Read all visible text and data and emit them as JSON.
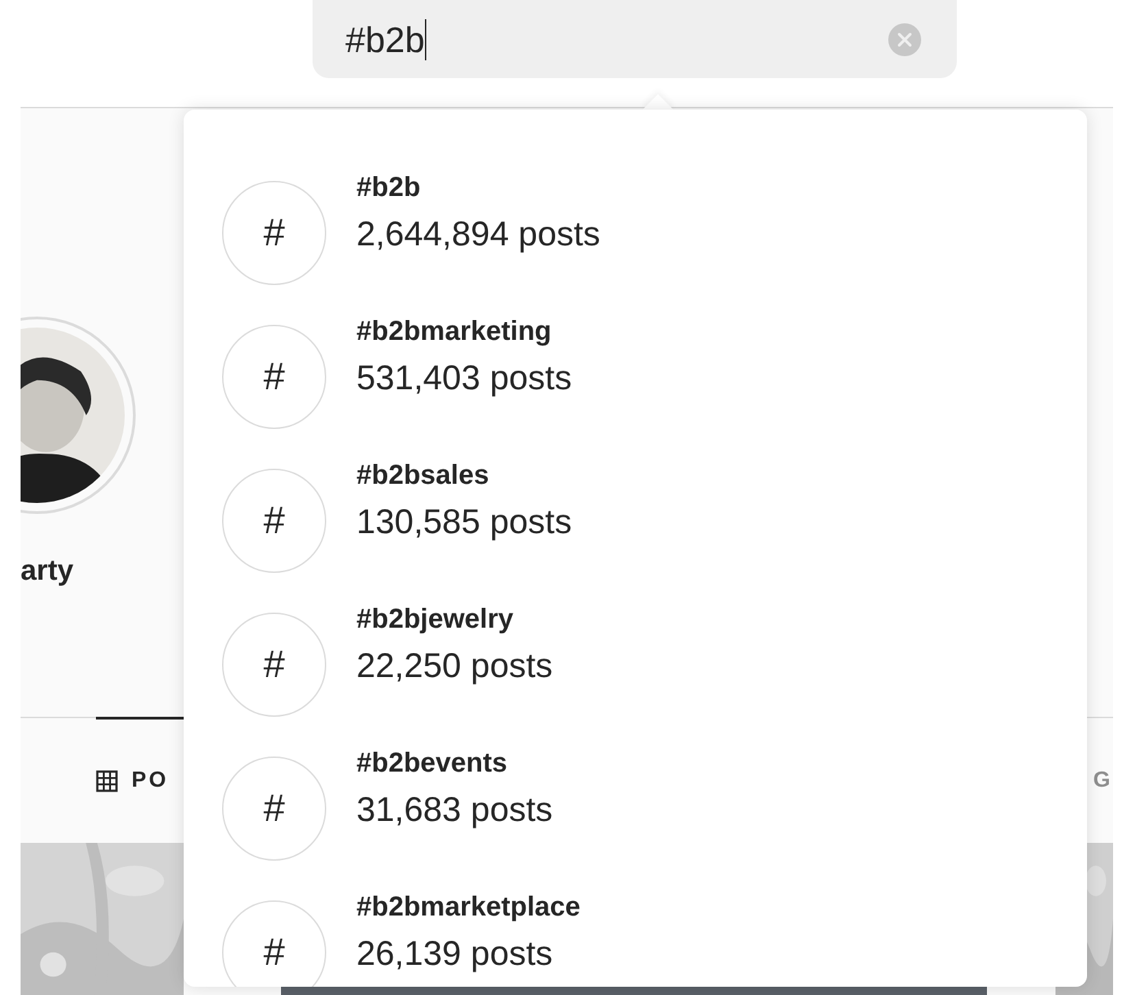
{
  "search": {
    "value": "#b2b"
  },
  "profile": {
    "name": "arty"
  },
  "tabs": [
    {
      "label": "PO",
      "selected": true
    },
    {
      "label": "G",
      "selected": false
    }
  ],
  "results": [
    {
      "symbol": "#",
      "tag": "#b2b",
      "count": "2,644,894 posts"
    },
    {
      "symbol": "#",
      "tag": "#b2bmarketing",
      "count": "531,403 posts"
    },
    {
      "symbol": "#",
      "tag": "#b2bsales",
      "count": "130,585 posts"
    },
    {
      "symbol": "#",
      "tag": "#b2bjewelry",
      "count": "22,250 posts"
    },
    {
      "symbol": "#",
      "tag": "#b2bevents",
      "count": "31,683 posts"
    },
    {
      "symbol": "#",
      "tag": "#b2bmarketplace",
      "count": "26,139 posts"
    }
  ]
}
